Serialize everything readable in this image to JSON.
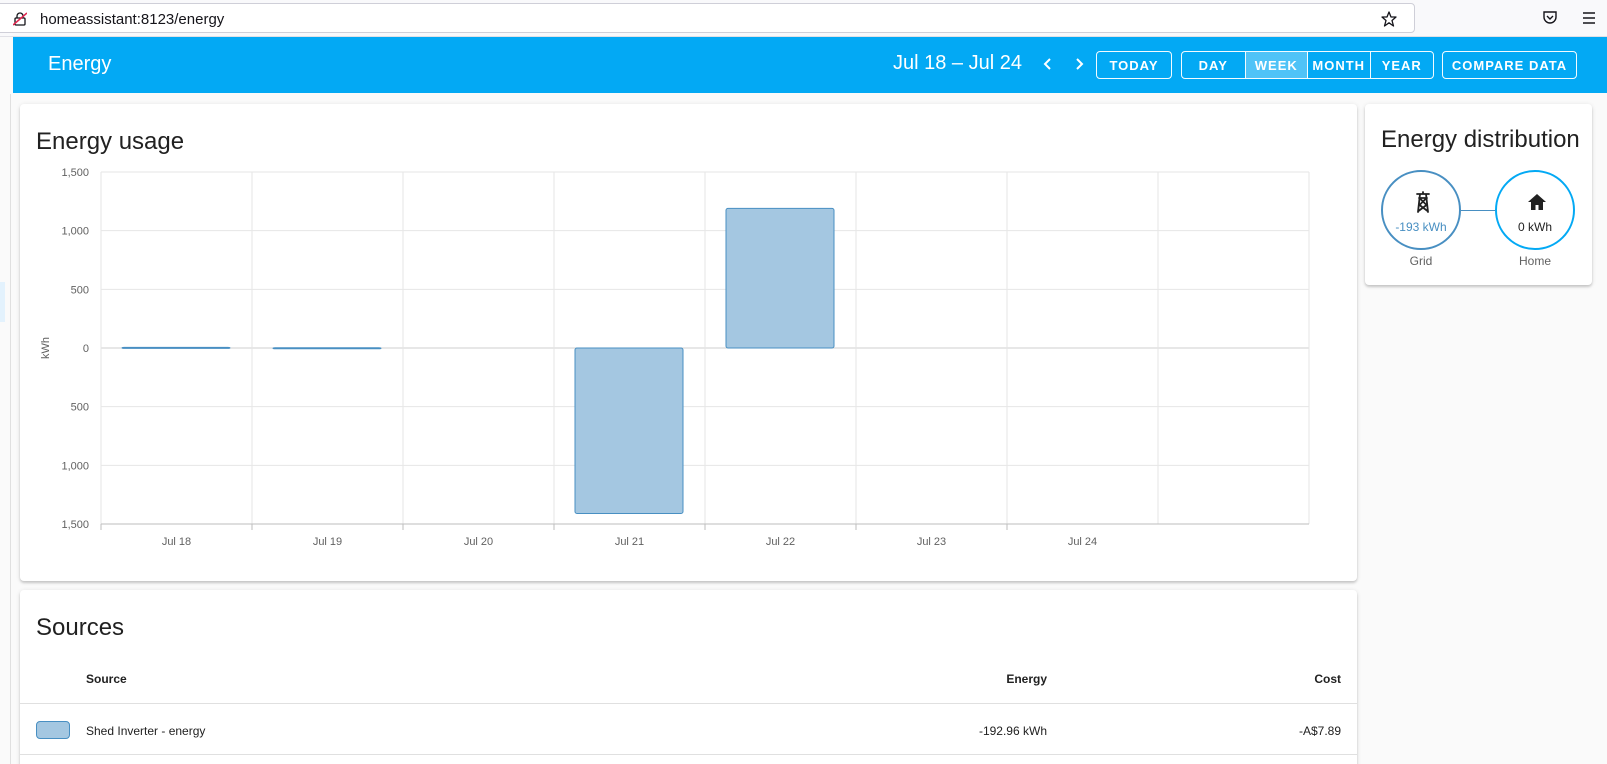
{
  "browser": {
    "url": "homeassistant:8123/energy"
  },
  "header": {
    "title": "Energy",
    "period": "Jul 18 – Jul 24",
    "today_label": "TODAY",
    "periods": [
      "DAY",
      "WEEK",
      "MONTH",
      "YEAR"
    ],
    "selected_period": "WEEK",
    "compare_label": "COMPARE DATA",
    "accent_color": "#03a9f4"
  },
  "usage": {
    "title": "Energy usage"
  },
  "chart_data": {
    "type": "bar",
    "title": "Energy usage",
    "ylabel": "kWh",
    "xlabel": "",
    "categories": [
      "Jul 18",
      "Jul 19",
      "Jul 20",
      "Jul 21",
      "Jul 22",
      "Jul 23",
      "Jul 24"
    ],
    "series": [
      {
        "name": "Shed Inverter - energy",
        "values": [
          5,
          2,
          0,
          -1410,
          1190,
          0,
          0
        ],
        "fill": "#a4c7e1",
        "stroke": "#488fc2"
      }
    ],
    "ylim": [
      -1500,
      1500
    ],
    "yticks": [
      1500,
      1000,
      500,
      0,
      -500,
      -1000,
      -1500
    ],
    "ytick_labels": [
      "1,500",
      "1,000",
      "500",
      "0",
      "500",
      "1,000",
      "1,500"
    ],
    "grid": true
  },
  "distribution": {
    "title": "Energy distribution",
    "grid": {
      "value": "-193 kWh",
      "label": "Grid",
      "icon": "transmission-tower-icon"
    },
    "home": {
      "value": "0 kWh",
      "label": "Home",
      "icon": "home-icon"
    }
  },
  "sources": {
    "title": "Sources",
    "columns": [
      "Source",
      "Energy",
      "Cost"
    ],
    "rows": [
      {
        "source": "Shed Inverter - energy",
        "energy": "-192.96 kWh",
        "cost": "-A$7.89",
        "color": "#a4c7e1"
      }
    ]
  }
}
